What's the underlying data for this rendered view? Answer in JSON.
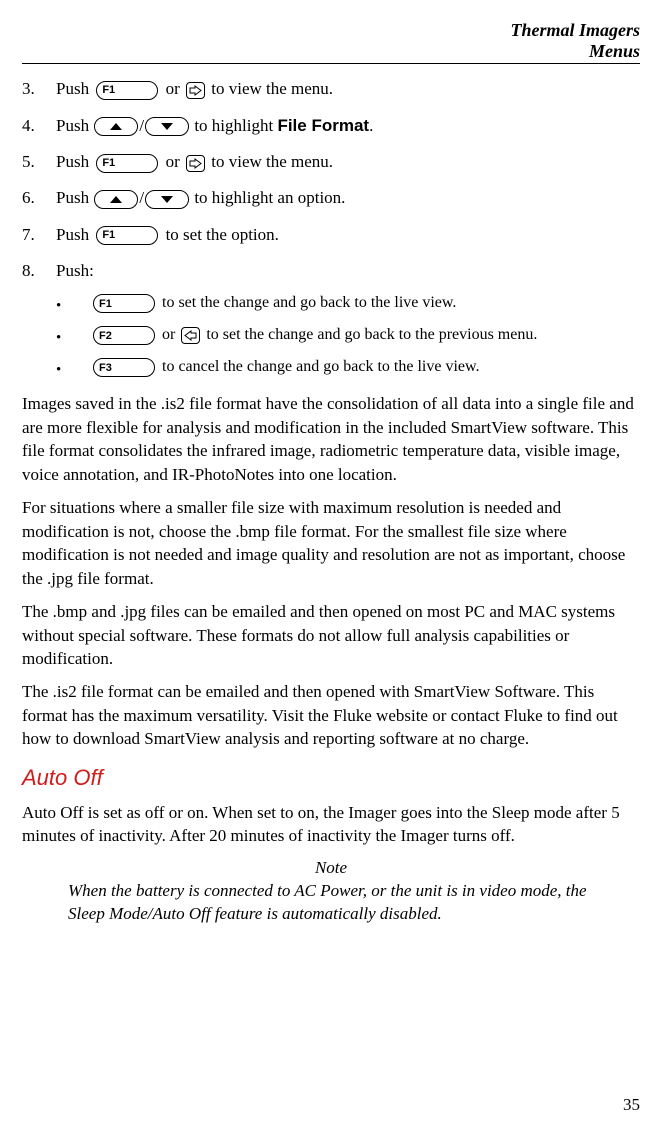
{
  "header": {
    "line1": "Thermal Imagers",
    "line2": "Menus"
  },
  "steps": {
    "s3": {
      "num": "3.",
      "pre": "Push ",
      "k": "F1",
      "mid": " or ",
      "post": " to view the menu."
    },
    "s4": {
      "num": "4.",
      "pre": "Push ",
      "post": " to highlight ",
      "target": "File Format",
      "end": "."
    },
    "s5": {
      "num": "5.",
      "pre": "Push ",
      "k": "F1",
      "mid": " or ",
      "post": " to view the menu."
    },
    "s6": {
      "num": "6.",
      "pre": "Push ",
      "post": " to highlight an option."
    },
    "s7": {
      "num": "7.",
      "pre": "Push ",
      "k": "F1",
      "post": " to set the option."
    },
    "s8": {
      "num": "8.",
      "pre": "Push:"
    }
  },
  "bullets": {
    "b1": {
      "k": "F1",
      "text": " to set the change and go back to the live view."
    },
    "b2": {
      "k": "F2",
      "mid": " or ",
      "text": " to set the change and go back to the previous menu."
    },
    "b3": {
      "k": "F3",
      "text": " to cancel the change and go back to the live view."
    }
  },
  "paras": {
    "p1": "Images saved in the .is2 file format have the consolidation of all data into a single file and are more flexible for analysis and modification in the included SmartView software. This file format consolidates the infrared image, radiometric temperature data, visible image, voice annotation, and IR-PhotoNotes into one location.",
    "p2": "For situations where a smaller file size with maximum resolution is needed and modification is not, choose the .bmp file format. For the smallest file size where modification is not needed and image quality and resolution are not as important, choose the .jpg file format.",
    "p3": "The .bmp and .jpg files can be emailed and then opened on most PC and MAC systems without special software. These formats do not allow full analysis capabilities or modification.",
    "p4": "The .is2 file format can be emailed and then opened with SmartView Software. This format has the maximum versatility. Visit the Fluke website or contact Fluke to find out how to download SmartView analysis and reporting software at no charge."
  },
  "section": {
    "title": "Auto Off",
    "body": "Auto Off is set as off or on. When set to on, the Imager goes into the Sleep mode after 5 minutes of inactivity. After 20 minutes of inactivity the Imager turns off."
  },
  "note": {
    "label": "Note",
    "body": "When the battery is connected to AC Power, or the unit is in video mode, the Sleep Mode/Auto Off feature is automatically disabled."
  },
  "pageNumber": "35"
}
